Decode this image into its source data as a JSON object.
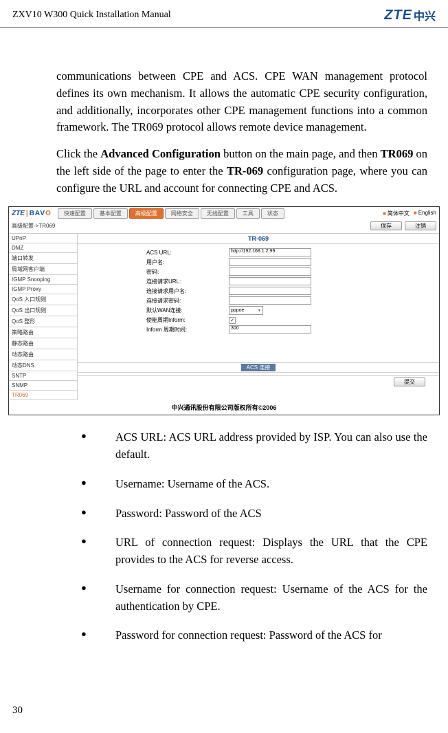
{
  "header": {
    "title": "ZXV10 W300 Quick Installation Manual",
    "logo_text": "ZTE",
    "logo_cn": "中兴"
  },
  "para1": "communications between CPE and ACS. CPE WAN management protocol defines its own mechanism. It allows the automatic CPE security configuration, and additionally, incorporates other CPE management functions into a common framework. The TR069 protocol allows remote device management.",
  "para2_a": "Click the ",
  "para2_b": "Advanced Configuration",
  "para2_c": " button on the main page, and then ",
  "para2_d": "TR069",
  "para2_e": " on the left side of the page to enter the ",
  "para2_f": "TR-069",
  "para2_g": " configuration page, where you can configure the URL and account for connecting CPE and ACS.",
  "screenshot": {
    "logo_zte": "ZTE",
    "logo_bav": "BAV",
    "logo_o": "O",
    "tabs": [
      "快速配置",
      "基本配置",
      "高级配置",
      "网络安全",
      "无线配置",
      "工具",
      "状态"
    ],
    "lang1": "简体中文",
    "lang2": "English",
    "breadcrumb": "高级配置->TR069",
    "btn_save": "保存",
    "btn_cancel": "注销",
    "sidebar": [
      "UPnP",
      "DMZ",
      "端口转发",
      "局域网客户端",
      "IGMP Snooping",
      "IGMP Proxy",
      "QoS 入口规则",
      "QoS 出口规则",
      "QoS 整形",
      "策略路由",
      "静态路由",
      "动态路由",
      "动态DNS",
      "SNTP",
      "SNMP",
      "TR069"
    ],
    "panel_title": "TR-069",
    "form": {
      "f1_label": "ACS URL:",
      "f1_value": "http://192.168.1.2:99",
      "f2_label": "用户名:",
      "f3_label": "密码:",
      "f4_label": "连接请求URL:",
      "f5_label": "连接请求用户名:",
      "f6_label": "连接请求密码:",
      "f7_label": "默认WAN连接:",
      "f7_value": "pppoe",
      "f8_label": "使能周期Inform:",
      "f8_check": "✓",
      "f9_label": "Inform 周期时间:",
      "f9_value": "300"
    },
    "acs_conn": "ACS 连接",
    "submit": "提交",
    "copyright": "中兴通讯股份有限公司版权所有©2006"
  },
  "bullets": [
    "ACS URL: ACS URL address provided by ISP. You can also use the default.",
    "Username: Username of the ACS.",
    "Password: Password of the ACS",
    "URL of connection request: Displays the URL that the CPE provides to the ACS for reverse access.",
    "Username for connection request: Username of the ACS for the authentication by CPE.",
    "Password for connection request: Password of the ACS for"
  ],
  "page_number": "30"
}
